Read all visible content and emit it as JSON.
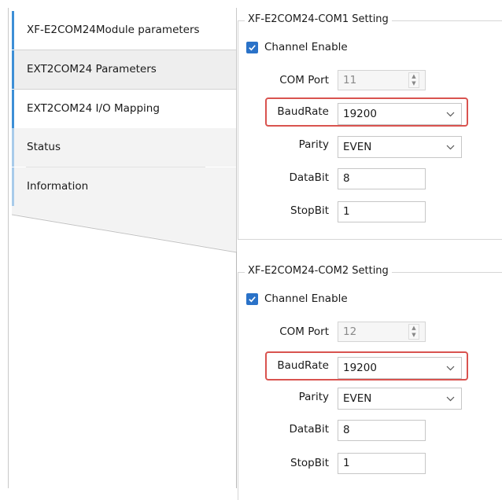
{
  "nav": {
    "items": [
      {
        "label": "XF-E2COM24Module parameters"
      },
      {
        "label": "EXT2COM24 Parameters"
      },
      {
        "label": "EXT2COM24 I/O Mapping"
      },
      {
        "label": "Status"
      },
      {
        "label": "Information"
      }
    ]
  },
  "groups": [
    {
      "title": "XF-E2COM24-COM1 Setting",
      "channel_enable_label": "Channel Enable",
      "com_port_label": "COM Port",
      "com_port_value": "11",
      "baud_label": "BaudRate",
      "baud_value": "19200",
      "parity_label": "Parity",
      "parity_value": "EVEN",
      "databit_label": "DataBit",
      "databit_value": "8",
      "stopbit_label": "StopBit",
      "stopbit_value": "1"
    },
    {
      "title": "XF-E2COM24-COM2 Setting",
      "channel_enable_label": "Channel Enable",
      "com_port_label": "COM Port",
      "com_port_value": "12",
      "baud_label": "BaudRate",
      "baud_value": "19200",
      "parity_label": "Parity",
      "parity_value": "EVEN",
      "databit_label": "DataBit",
      "databit_value": "8",
      "stopbit_label": "StopBit",
      "stopbit_value": "1"
    }
  ],
  "colors": {
    "accent": "#2a72c8",
    "highlight": "#d9534f"
  }
}
